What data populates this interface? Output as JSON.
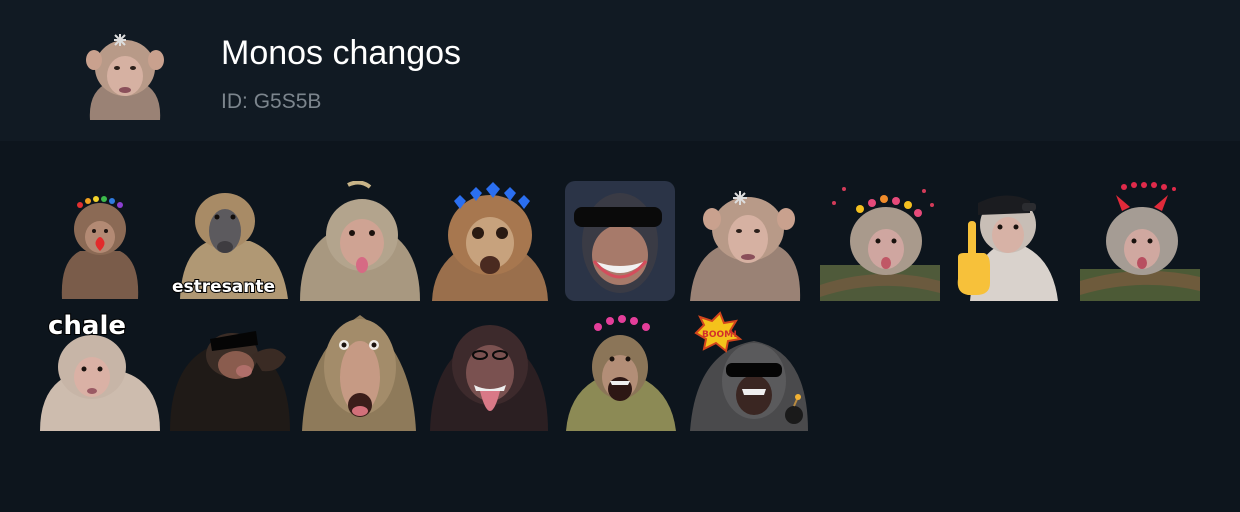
{
  "pack": {
    "title": "Monos changos",
    "id_label": "ID:",
    "id_value": "G5S5B"
  },
  "stickers": [
    {
      "name": "sticker-heart-crown-monkey",
      "caption": ""
    },
    {
      "name": "sticker-baboon-stressed",
      "caption": "estresante"
    },
    {
      "name": "sticker-macaque-tongue",
      "caption": ""
    },
    {
      "name": "sticker-monkey-blue-hearts",
      "caption": ""
    },
    {
      "name": "sticker-chimp-sunglasses-smile",
      "caption": ""
    },
    {
      "name": "sticker-macaque-pouting",
      "caption": ""
    },
    {
      "name": "sticker-macaque-flower-crown",
      "caption": ""
    },
    {
      "name": "sticker-macaque-cap-finger",
      "caption": ""
    },
    {
      "name": "sticker-macaque-devil-horns",
      "caption": ""
    },
    {
      "name": "sticker-macaque-chale",
      "caption": "chale"
    },
    {
      "name": "sticker-chimp-sunglasses-kiss",
      "caption": ""
    },
    {
      "name": "sticker-macaque-surprised",
      "caption": ""
    },
    {
      "name": "sticker-chimp-tongue",
      "caption": ""
    },
    {
      "name": "sticker-baboon-hearts-yelling",
      "caption": ""
    },
    {
      "name": "sticker-chimp-boom-sunglasses",
      "caption": "BOOM!"
    }
  ],
  "colors": {
    "page_bg": "#0d151d",
    "header_bg": "#111a23",
    "title": "#ffffff",
    "id_text": "#7c858d"
  }
}
